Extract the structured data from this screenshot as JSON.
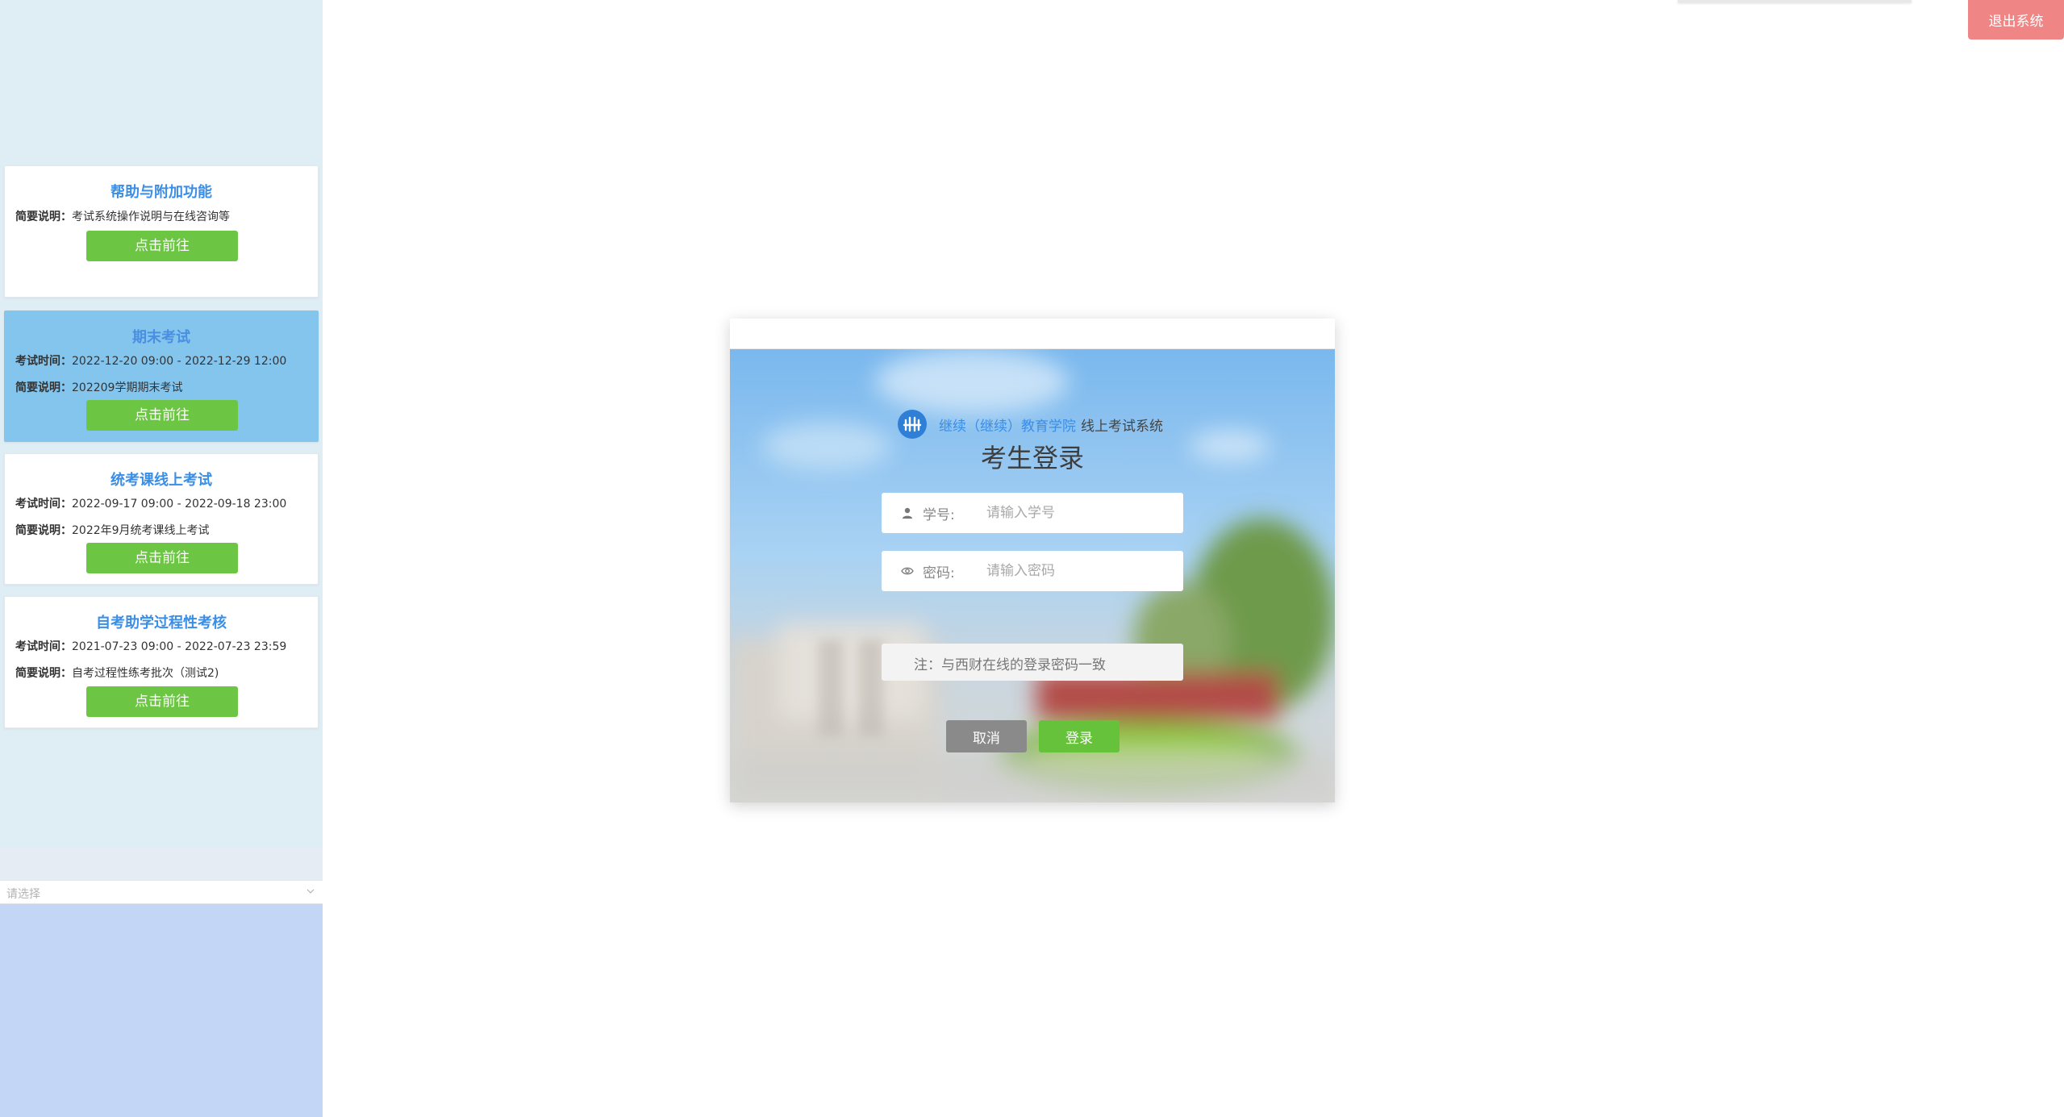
{
  "sidebar": {
    "cards": [
      {
        "title": "帮助与附加功能",
        "time_label": "",
        "time_value": "",
        "desc_label": "简要说明：",
        "desc_value": "考试系统操作说明与在线咨询等",
        "button_label": "点击前往"
      },
      {
        "title": "期末考试",
        "time_label": "考试时间：",
        "time_value": "2022-12-20 09:00 - 2022-12-29 12:00",
        "desc_label": "简要说明：",
        "desc_value": "202209学期期末考试",
        "button_label": "点击前往"
      },
      {
        "title": "统考课线上考试",
        "time_label": "考试时间：",
        "time_value": "2022-09-17 09:00 - 2022-09-18 23:00",
        "desc_label": "简要说明：",
        "desc_value": "2022年9月统考课线上考试",
        "button_label": "点击前往"
      },
      {
        "title": "自考助学过程性考核",
        "time_label": "考试时间：",
        "time_value": "2021-07-23 09:00 - 2022-07-23 23:59",
        "desc_label": "简要说明：",
        "desc_value": "自考过程性练考批次（测试2)",
        "button_label": "点击前往"
      }
    ],
    "select": {
      "placeholder": "请选择"
    }
  },
  "header": {
    "logout_label": "退出系统"
  },
  "login": {
    "brand_name": "继续（继续）教育学院",
    "brand_system": "线上考试系统",
    "title": "考生登录",
    "student_id_label": "学号:",
    "student_id_placeholder": "请输入学号",
    "password_label": "密码:",
    "password_placeholder": "请输入密码",
    "note": "注：与西财在线的登录密码一致",
    "cancel_label": "取消",
    "submit_label": "登录"
  },
  "colors": {
    "accent_blue": "#3a8ee6",
    "go_green": "#6cc644",
    "logout_red": "#f08585",
    "active_card": "#84c5ee"
  },
  "icons": [
    "school-logo-icon",
    "user-icon",
    "eye-icon",
    "chevron-down-icon"
  ]
}
